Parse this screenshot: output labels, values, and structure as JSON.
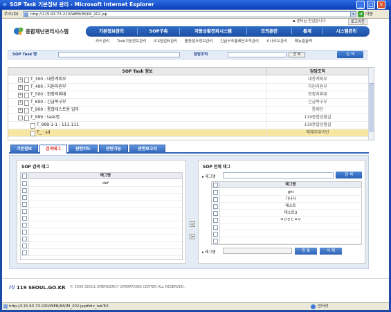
{
  "window": {
    "title": "SOP Task 기본정보 관리 - Microsoft Internet Explorer",
    "ie_icon": "ie-logo-icon",
    "minimize": "_",
    "maximize": "□",
    "close": "×"
  },
  "address": {
    "label": "주소(D)",
    "url": "http://115.93.73.220/WEB/IM/IM_202.jsp",
    "go_label": "이동"
  },
  "header": {
    "logo_text": "종합재난관리시스템",
    "top_link": "▪ 센터님 반갑습니다",
    "logout_label": "로그아웃"
  },
  "mainnav": [
    "기본정보관리",
    "SOP구축",
    "자동상황전파시스템",
    "모의훈련",
    "통계",
    "시스템관리"
  ],
  "subnav": [
    "카드관리",
    "Task기본정보관리",
    "ICS접검표관리",
    "활동점조정보관리",
    "긴급구조통제단조직관리",
    "시나리오관리",
    "매뉴얼출력"
  ],
  "search": {
    "task_name_label": "SOP Task 명",
    "org_label": "담당조직",
    "select_label": "선 택",
    "search_label": "검 색"
  },
  "grid": {
    "col_task": "SOP Task 정보",
    "col_org": "담당조직",
    "rows": [
      {
        "indent": 0,
        "exp": "+",
        "task": "T_300 : 대응계획부",
        "org": "대응계획부",
        "selected": false
      },
      {
        "indent": 0,
        "exp": "+",
        "task": "T_400 : 자원지원부",
        "org": "자원지원부",
        "selected": false
      },
      {
        "indent": 0,
        "exp": "+",
        "task": "T_500 : 현장지휘대",
        "org": "현장지휘대",
        "selected": false
      },
      {
        "indent": 0,
        "exp": "+",
        "task": "T_600 : 긴급복구부",
        "org": "긴급복구부",
        "selected": false
      },
      {
        "indent": 0,
        "exp": "+",
        "task": "T_900 : 통합테스트용 임무",
        "org": "통제단",
        "selected": false
      },
      {
        "indent": 0,
        "exp": "-",
        "task": "T_999 : task명",
        "org": "119종합상황실",
        "selected": false
      },
      {
        "indent": 1,
        "exp": "",
        "task": "T_999-1-1 : 111-111",
        "org": "119종합상황실",
        "selected": false
      },
      {
        "indent": 1,
        "exp": "",
        "task": "T_ : sd",
        "org": "매체지위리반",
        "selected": true
      }
    ]
  },
  "tabs": [
    "기본정보",
    "검색태그",
    "관련카드",
    "관련기능",
    "관련보고서"
  ],
  "left_panel": {
    "title": "SOP 검색 태그",
    "col_name": "태그명",
    "rows": [
      "def",
      "",
      "",
      "",
      "",
      "",
      "",
      "",
      "",
      "",
      ""
    ]
  },
  "right_panel": {
    "title": "SOP 전체 태그",
    "search_label": "▸ 태그명",
    "search_btn": "검 색",
    "col_name": "태그명",
    "rows": [
      "ghi",
      "가나다",
      "테스트",
      "테스트3",
      "ㅁㅇㄹㄷㅁㅇ",
      "",
      "",
      ""
    ],
    "bottom_label": "▸ 태그명",
    "register_btn": "등 록",
    "delete_btn": "삭 제"
  },
  "arrows": {
    "left": "<",
    "right": ">"
  },
  "footer": {
    "logo_a": "HI",
    "logo_b": "119 SEOUL.GO.KR",
    "copyright": "© 2006 SEOUL EMERGENCY OPERATIONS CENTER ALL RESERVED."
  },
  "status": {
    "url": "http://115.93.73.220/WEB/IM/IM_202.jsp#div_tabTr2",
    "zone": "인터넷"
  }
}
